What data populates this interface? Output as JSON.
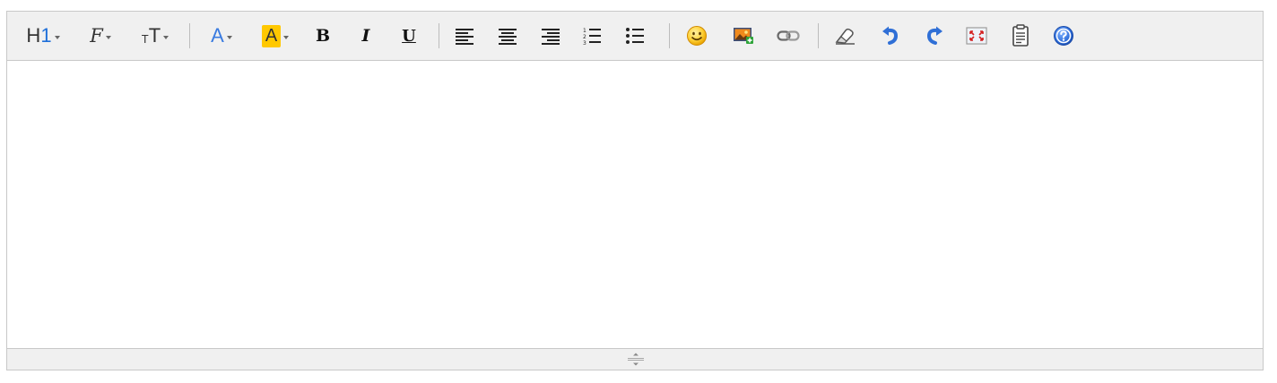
{
  "toolbar": {
    "heading_label": "H",
    "heading_level": "1",
    "font_family_label": "F",
    "font_size_small": "T",
    "font_size_large": "T",
    "text_color_label": "A",
    "highlight_label": "A",
    "bold_label": "B",
    "italic_label": "I",
    "underline_label": "U",
    "items": [
      "heading",
      "font-family",
      "font-size",
      "text-color",
      "highlight-color",
      "bold",
      "italic",
      "underline",
      "align-left",
      "align-center",
      "align-right",
      "ordered-list",
      "unordered-list",
      "emoji",
      "insert-image",
      "insert-link",
      "clear-formatting",
      "undo",
      "redo",
      "fullscreen",
      "paste-text",
      "help"
    ]
  },
  "colors": {
    "toolbar_bg": "#f0f0f0",
    "border": "#c8c8c8",
    "heading_accent": "#1e6fd9",
    "text_color_accent": "#3a7be0",
    "highlight_bg": "#ffc800",
    "undo_redo": "#2f6fd6",
    "help": "#2a6ad8"
  },
  "editor": {
    "content": ""
  }
}
